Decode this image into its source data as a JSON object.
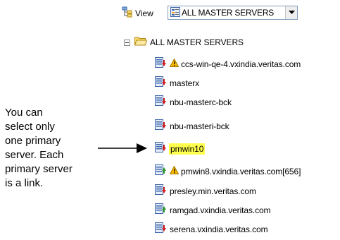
{
  "toolbar": {
    "view_label": "View",
    "view_icon": "view-icon",
    "select_value": "ALL MASTER SERVERS",
    "select_icon": "server-list-icon",
    "dropdown_icon": "chevron-down-icon"
  },
  "tree": {
    "root_label": "ALL MASTER SERVERS",
    "root_expanded": true,
    "items": [
      {
        "label": "ccs-win-qe-4.vxindia.veritas.com",
        "status": "down",
        "warning": true
      },
      {
        "label": "masterx",
        "status": "down",
        "warning": false
      },
      {
        "label": "nbu-masterc-bck",
        "status": "down",
        "warning": false
      },
      {
        "label": "nbu-masteri-bck",
        "status": "down",
        "warning": false
      },
      {
        "label": "pmwin10",
        "status": "down",
        "warning": false,
        "selected": true
      },
      {
        "label": "pmwin8.vxindia.veritas.com[656]",
        "status": "up",
        "warning": true
      },
      {
        "label": "presley.min.veritas.com",
        "status": "down",
        "warning": false
      },
      {
        "label": "ramgad.vxindia.veritas.com",
        "status": "up",
        "warning": false
      },
      {
        "label": "serena.vxindia.veritas.com",
        "status": "down",
        "warning": false
      }
    ]
  },
  "callout": {
    "lines": [
      "You can",
      "select only",
      "one primary",
      "server. Each",
      "primary server",
      "is a link."
    ]
  },
  "colors": {
    "selection_highlight": "#ffff4d",
    "status_down": "#d42020",
    "status_up": "#2e9b2e",
    "warning": "#f5b800",
    "server_icon": "#3a63a8"
  }
}
